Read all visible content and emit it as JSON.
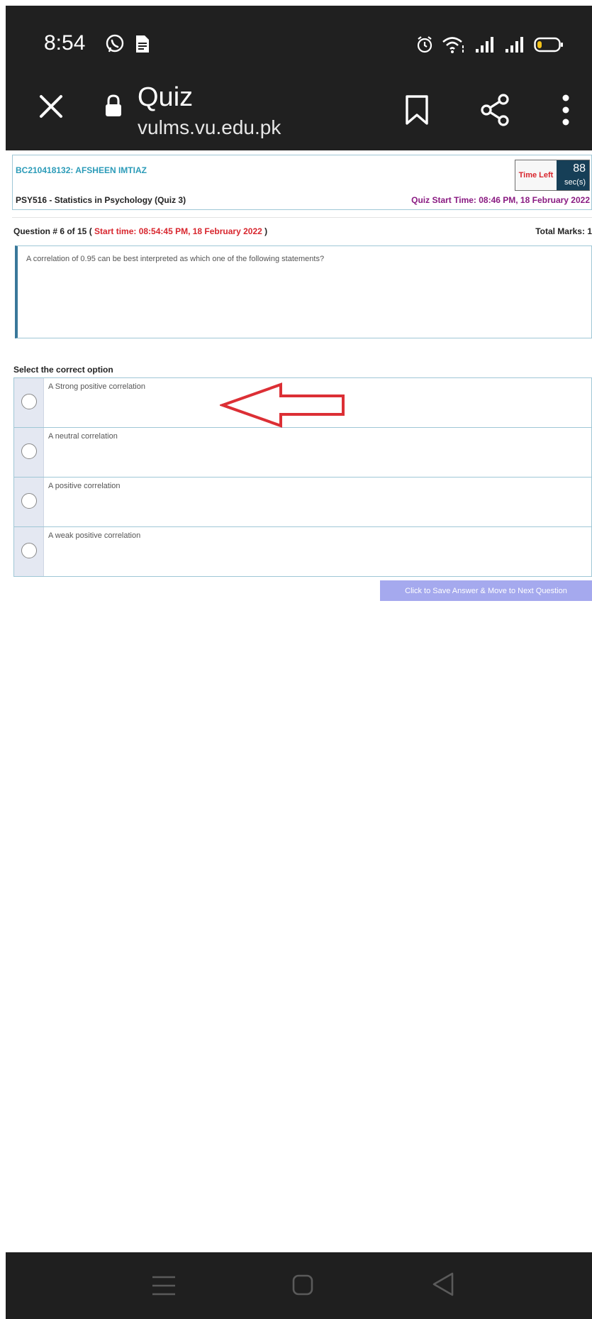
{
  "status_bar": {
    "time": "8:54",
    "left_icons": [
      "whatsapp-icon",
      "document-notification-icon"
    ],
    "right_icons": [
      "alarm-icon",
      "wifi-icon",
      "signal-icon",
      "signal-icon",
      "battery-icon"
    ]
  },
  "browser": {
    "title": "Quiz",
    "host": "vulms.vu.edu.pk"
  },
  "header": {
    "student": "BC210418132: AFSHEEN IMTIAZ",
    "course": "PSY516 - Statistics in Psychology (Quiz 3)",
    "quiz_start": "Quiz Start Time: 08:46 PM, 18 February 2022",
    "timer_label": "Time Left",
    "timer_value": "88",
    "timer_unit": "sec(s)"
  },
  "question": {
    "prefix": "Question # 6 of 15 ( ",
    "start_time": "Start time: 08:54:45 PM, 18 February 2022",
    "suffix": " )",
    "total_marks": "Total Marks: 1",
    "text": "A correlation of 0.95 can be best interpreted as which one of the following statements?"
  },
  "options": {
    "label": "Select the correct option",
    "items": [
      "A Strong positive correlation",
      "A neutral correlation",
      "A positive correlation",
      "A weak positive correlation"
    ]
  },
  "actions": {
    "next_label": "Click to Save Answer & Move to Next Question"
  },
  "colors": {
    "toolbar": "#202020",
    "accent_teal": "#2b9bb8",
    "accent_red": "#d8262e",
    "accent_purple": "#8a1b82",
    "button": "#a5a9ee",
    "timer_bg": "#163f57",
    "annotation_arrow": "#dc2f35"
  }
}
